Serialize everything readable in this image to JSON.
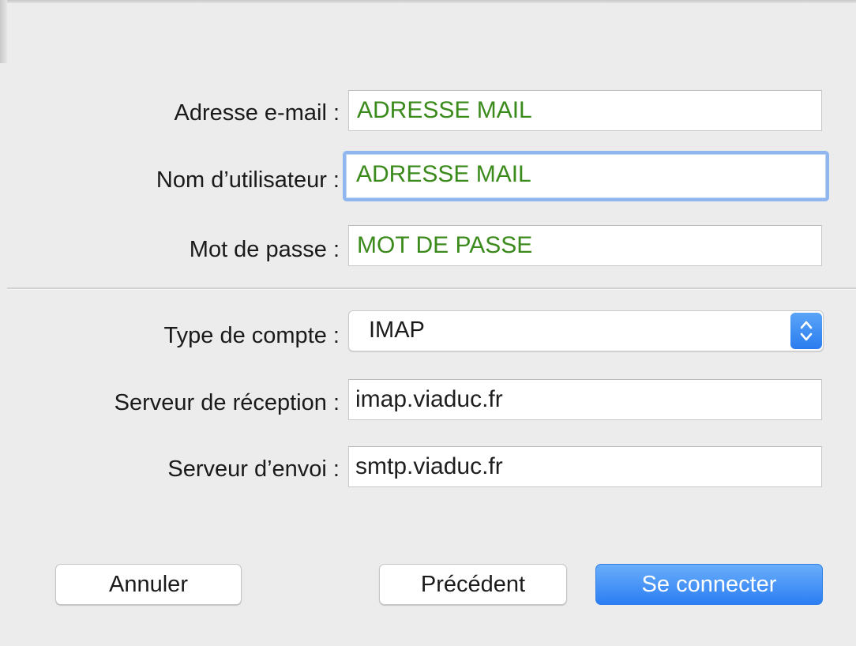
{
  "form": {
    "email": {
      "label": "Adresse e-mail :",
      "value": "ADRESSE MAIL"
    },
    "username": {
      "label": "Nom d’utilisateur :",
      "value": "ADRESSE MAIL"
    },
    "password": {
      "label": "Mot de passe :",
      "value": "MOT DE PASSE"
    },
    "account_type": {
      "label": "Type de compte :",
      "value": "IMAP"
    },
    "incoming_server": {
      "label": "Serveur de réception :",
      "value": "imap.viaduc.fr"
    },
    "outgoing_server": {
      "label": "Serveur d’envoi :",
      "value": "smtp.viaduc.fr"
    }
  },
  "buttons": {
    "cancel": "Annuler",
    "previous": "Précédent",
    "connect": "Se connecter"
  },
  "icons": {
    "select_stepper": "up-down-chevron-icon"
  },
  "colors": {
    "value_green": "#3b8a1c",
    "focus_ring": "#8fb6ee",
    "primary_button": "#2b7ef3"
  }
}
